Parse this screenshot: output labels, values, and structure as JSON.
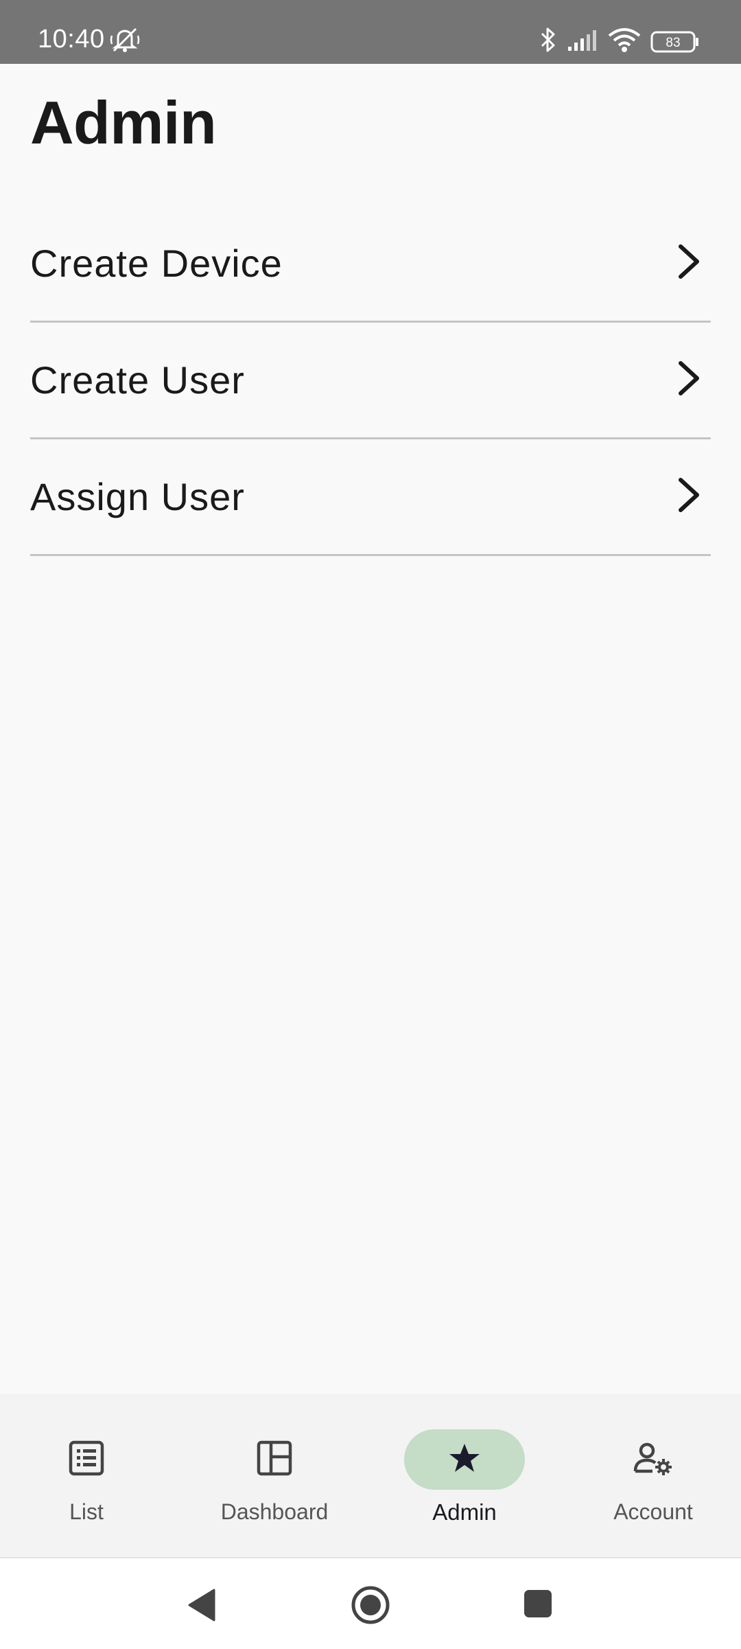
{
  "status_bar": {
    "time": "10:40",
    "battery": "83",
    "icons": [
      "alarm-off-icon",
      "bluetooth-icon",
      "signal-icon",
      "wifi-icon",
      "battery-icon"
    ]
  },
  "page": {
    "title": "Admin"
  },
  "menu": {
    "items": [
      {
        "label": "Create Device",
        "icon": "chevron-right-icon"
      },
      {
        "label": "Create User",
        "icon": "chevron-right-icon"
      },
      {
        "label": "Assign User",
        "icon": "chevron-right-icon"
      }
    ]
  },
  "bottom_nav": {
    "items": [
      {
        "label": "List",
        "icon": "list-icon",
        "active": false
      },
      {
        "label": "Dashboard",
        "icon": "dashboard-icon",
        "active": false
      },
      {
        "label": "Admin",
        "icon": "star-icon",
        "active": true
      },
      {
        "label": "Account",
        "icon": "account-settings-icon",
        "active": false
      }
    ]
  },
  "system_nav": {
    "icons": [
      "back-icon",
      "home-icon",
      "recents-icon"
    ]
  },
  "colors": {
    "status_bar": "#757575",
    "background": "#f9f9f9",
    "active_pill": "#c5dcc6",
    "divider": "#c4c4c4"
  }
}
